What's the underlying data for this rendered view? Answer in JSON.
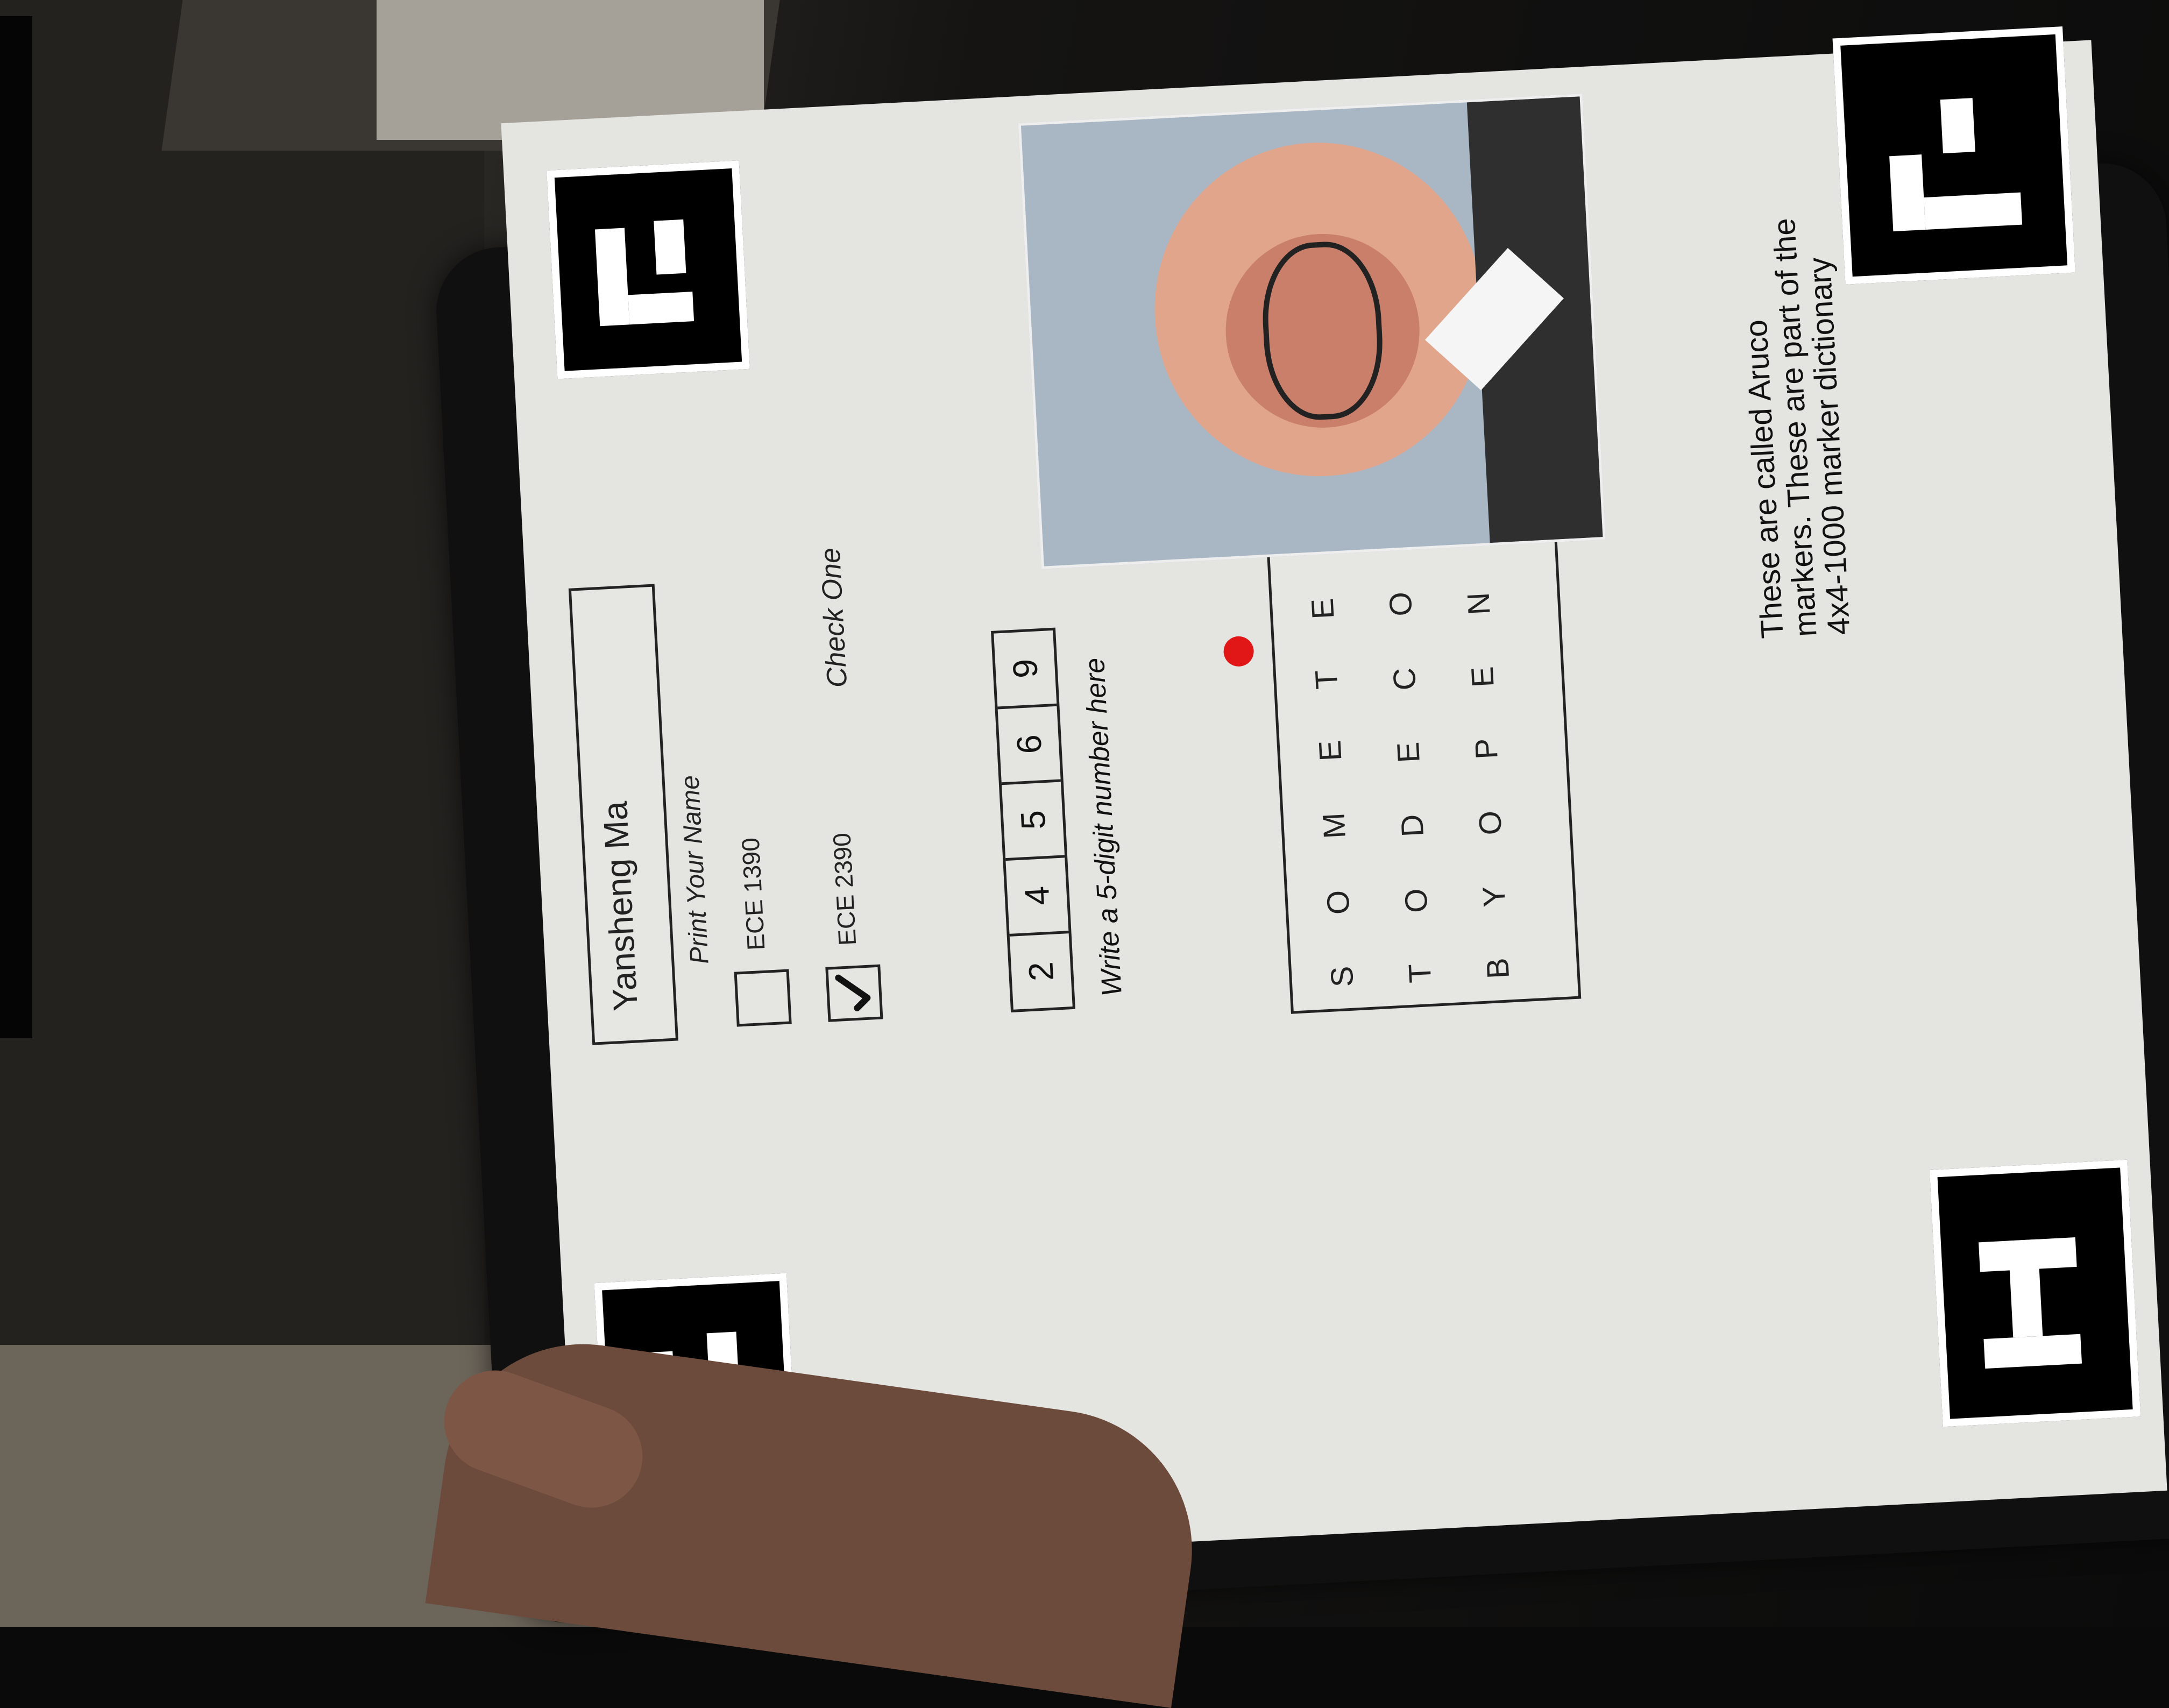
{
  "form": {
    "name_value": "Yansheng Ma",
    "name_label": "Print Your Name",
    "option_1_label": "ECE 1390",
    "option_2_label": "ECE 2390",
    "check_one_label": "Check One",
    "digits": [
      "2",
      "4",
      "5",
      "6",
      "9"
    ],
    "digit_instruction": "Write a 5-digit number here",
    "text_rows": [
      "S O M E T E X T",
      "T O D E C O D E",
      "B Y O P E N C V"
    ],
    "aruco_note": "These are called Aruco markers. These are part of the 4x4-1000 marker dictionary"
  },
  "colors": {
    "paper": "#e4e4e1",
    "ink": "#222222",
    "red_dot": "#e11717"
  },
  "icons": {
    "marker_top_left": "aruco-marker-icon",
    "marker_top_right": "aruco-marker-icon",
    "marker_bottom_left": "aruco-marker-icon",
    "marker_bottom_right": "aruco-marker-icon",
    "checkmark": "checkmark-icon"
  },
  "state": {
    "option_2_checked": true
  }
}
